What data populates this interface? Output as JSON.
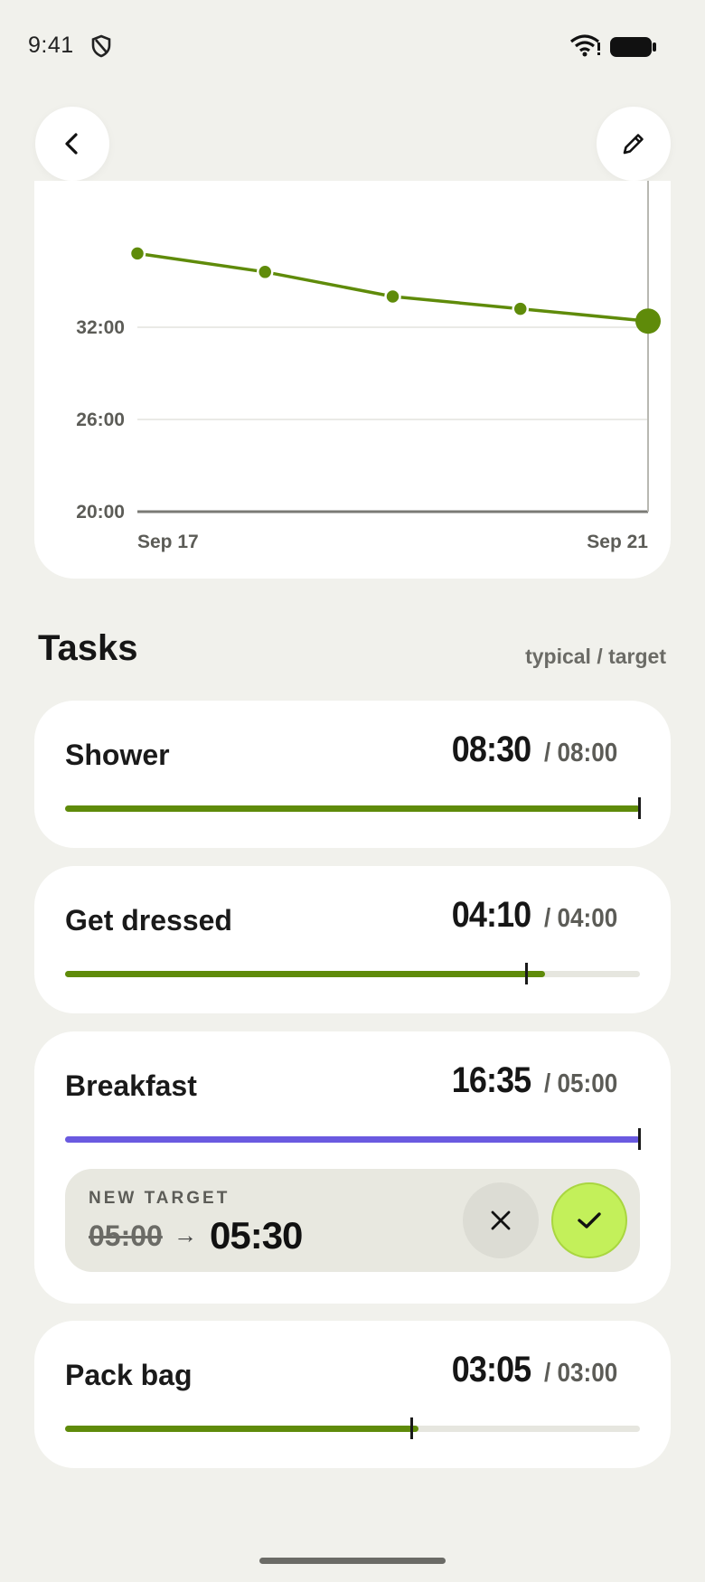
{
  "status_bar": {
    "time": "9:41",
    "icons": [
      "shield-icon",
      "wifi-icon",
      "battery-icon"
    ]
  },
  "nav": {
    "back_icon": "chevron-left-icon",
    "edit_icon": "pencil-icon"
  },
  "chart_data": {
    "type": "line",
    "x": [
      "Sep 17",
      "Sep 18",
      "Sep 19",
      "Sep 20",
      "Sep 21"
    ],
    "values": [
      36.8,
      35.6,
      34.0,
      33.2,
      32.4
    ],
    "y_ticks": [
      "32:00",
      "26:00",
      "20:00"
    ],
    "x_tick_labels": [
      "Sep 17",
      "Sep 21"
    ],
    "ylim": [
      20,
      38
    ],
    "color": "#5f8b0a",
    "grid": true
  },
  "tasks": {
    "title": "Tasks",
    "legend": "typical / target",
    "items": [
      {
        "name": "Shower",
        "typical": "08:30",
        "target": "/ 08:00",
        "progress": 1.0,
        "marker": 1.0,
        "color": "#5f8b0a"
      },
      {
        "name": "Get dressed",
        "typical": "04:10",
        "target": "/ 04:00",
        "progress": 0.835,
        "marker": 0.8,
        "color": "#5f8b0a"
      },
      {
        "name": "Breakfast",
        "typical": "16:35",
        "target": "/ 05:00",
        "progress": 1.0,
        "marker": 1.0,
        "color": "#6a5ae0"
      },
      {
        "name": "Pack bag",
        "typical": "03:05",
        "target": "/ 03:00",
        "progress": 0.615,
        "marker": 0.6,
        "color": "#5f8b0a"
      }
    ]
  },
  "new_target": {
    "label": "NEW TARGET",
    "old_value": "05:00",
    "arrow": "→",
    "new_value": "05:30",
    "cancel_icon": "close-icon",
    "confirm_icon": "check-icon"
  }
}
